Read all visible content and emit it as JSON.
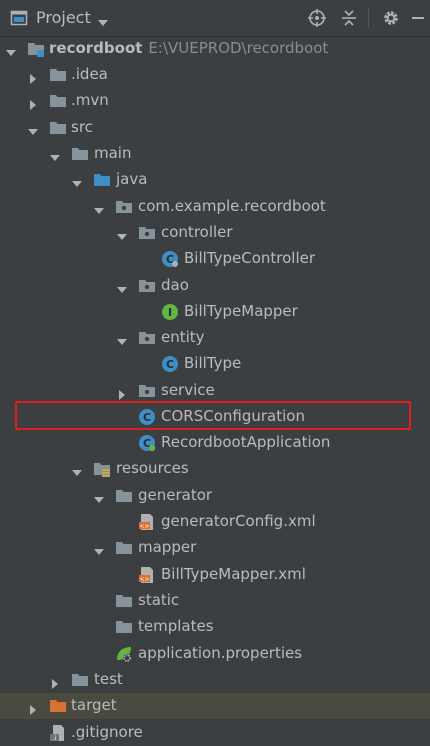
{
  "panel": {
    "title": "Project",
    "icons": [
      "project-window-icon",
      "chevron-down-icon",
      "locate-icon",
      "collapse-all-icon",
      "gear-icon",
      "hide-icon"
    ]
  },
  "tree": {
    "root": {
      "label": "recordboot",
      "path": "E:\\VUEPROD\\recordboot"
    },
    "items": [
      {
        "label": ".idea"
      },
      {
        "label": ".mvn"
      },
      {
        "label": "src"
      },
      {
        "label": "main"
      },
      {
        "label": "java"
      },
      {
        "label": "com.example.recordboot"
      },
      {
        "label": "controller"
      },
      {
        "label": "BillTypeController"
      },
      {
        "label": "dao"
      },
      {
        "label": "BillTypeMapper"
      },
      {
        "label": "entity"
      },
      {
        "label": "BillType"
      },
      {
        "label": "service"
      },
      {
        "label": "CORSConfiguration"
      },
      {
        "label": "RecordbootApplication"
      },
      {
        "label": "resources"
      },
      {
        "label": "generator"
      },
      {
        "label": "generatorConfig.xml"
      },
      {
        "label": "mapper"
      },
      {
        "label": "BillTypeMapper.xml"
      },
      {
        "label": "static"
      },
      {
        "label": "templates"
      },
      {
        "label": "application.properties"
      },
      {
        "label": "test"
      },
      {
        "label": "target"
      },
      {
        "label": ".gitignore"
      }
    ]
  },
  "colors": {
    "background": "#3c3f41",
    "text": "#bbbbbb",
    "folder": "#87939a",
    "source_folder": "#3d8fc6",
    "excluded_folder": "#d87132",
    "class_icon": "#3d8fc6",
    "interface_icon": "#62b543",
    "highlight_border": "#e0201c",
    "selection": "#4b4a3e"
  }
}
